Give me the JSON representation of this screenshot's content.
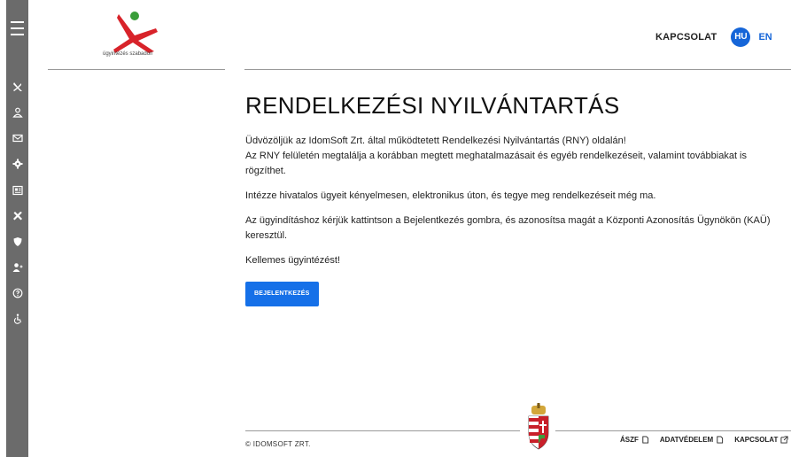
{
  "brand": {
    "tagline": "ügyintézés szabadon"
  },
  "header": {
    "contact": "KAPCSOLAT",
    "lang_hu": "HU",
    "lang_en": "EN"
  },
  "sidebar": {
    "icons": [
      "menu-icon",
      "brand-icon",
      "user-icon",
      "mail-icon",
      "gear-icon",
      "newspaper-icon",
      "tools-icon",
      "shield-icon",
      "add-user-icon",
      "help-icon",
      "accessibility-icon"
    ]
  },
  "main": {
    "title": "RENDELKEZÉSI NYILVÁNTARTÁS",
    "p1_line1": "Üdvözöljük az IdomSoft Zrt. által működtetett Rendelkezési Nyilvántartás (RNY) oldalán!",
    "p1_line2": "Az RNY felületén megtalálja a korábban megtett meghatalmazásait és egyéb rendelkezéseit, valamint továbbiakat is rögzíthet.",
    "p2": "Intézze hivatalos ügyeit kényelmesen, elektronikus úton, és tegye meg rendelkezéseit még ma.",
    "p3": "Az ügyindításhoz kérjük kattintson a Bejelentkezés gombra, és azonosítsa magát a Központi Azonosítás Ügynökön (KAÜ) keresztül.",
    "p4": "Kellemes ügyintézést!",
    "login_button": "BEJELENTKEZÉS"
  },
  "footer": {
    "copyright": "© IDOMSOFT ZRT.",
    "links": [
      "ÁSZF",
      "ADATVÉDELEM",
      "KAPCSOLAT"
    ]
  },
  "colors": {
    "accent": "#1570e8",
    "sidebar": "#6b6b6b",
    "logo_red": "#d8232a",
    "logo_green": "#3a9e3a"
  }
}
